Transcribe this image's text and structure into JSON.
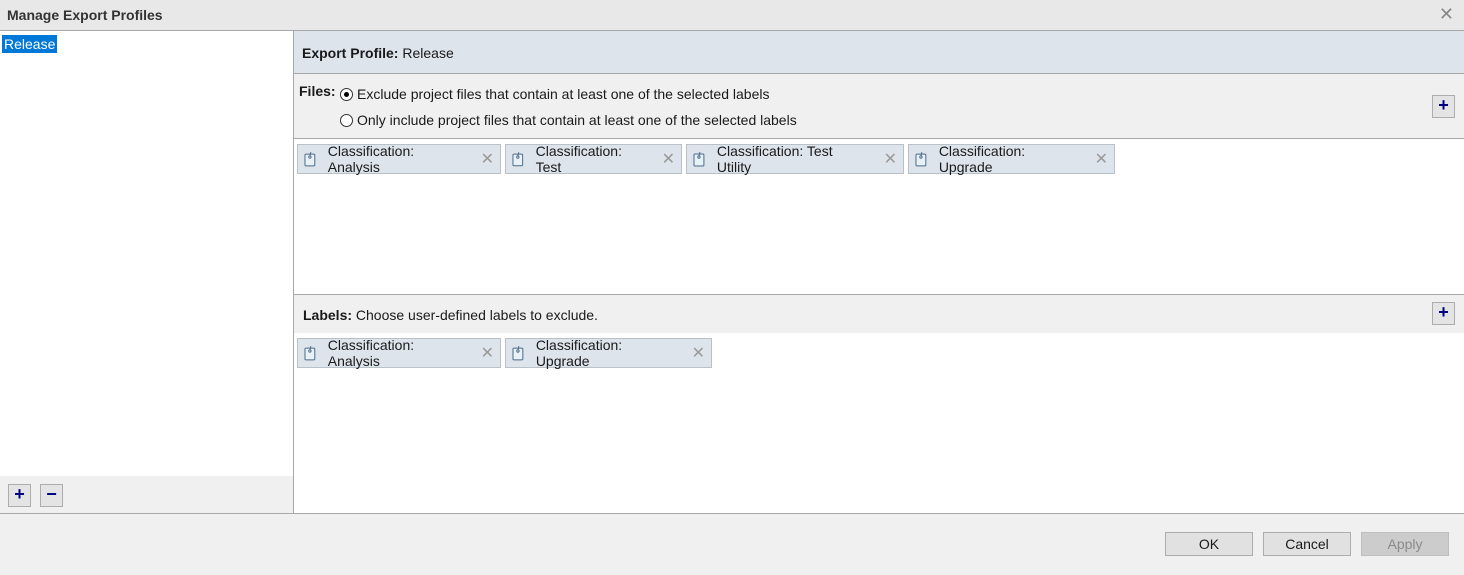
{
  "window": {
    "title": "Manage Export Profiles",
    "close_icon": "close-icon"
  },
  "profiles": {
    "items": [
      {
        "label": "Release",
        "selected": true
      }
    ],
    "add_label": "+",
    "remove_label": "−"
  },
  "profile_header": {
    "label": "Export Profile:",
    "value": "Release"
  },
  "files": {
    "label": "Files:",
    "options": [
      {
        "label": "Exclude project files that contain at least one of the selected labels",
        "checked": true
      },
      {
        "label": "Only include project files that contain at least one of the selected labels",
        "checked": false
      }
    ],
    "add_label": "+",
    "chips": [
      {
        "label": "Classification: Analysis"
      },
      {
        "label": "Classification: Test"
      },
      {
        "label": "Classification: Test Utility"
      },
      {
        "label": "Classification: Upgrade"
      }
    ]
  },
  "labels": {
    "label": "Labels:",
    "description": "Choose user-defined labels to exclude.",
    "add_label": "+",
    "chips": [
      {
        "label": "Classification: Analysis"
      },
      {
        "label": "Classification: Upgrade"
      }
    ]
  },
  "buttons": {
    "ok": "OK",
    "cancel": "Cancel",
    "apply": "Apply"
  },
  "colors": {
    "accent": "#0078d7",
    "header_bg": "#dde4ec",
    "icon_blue": "#000080"
  }
}
